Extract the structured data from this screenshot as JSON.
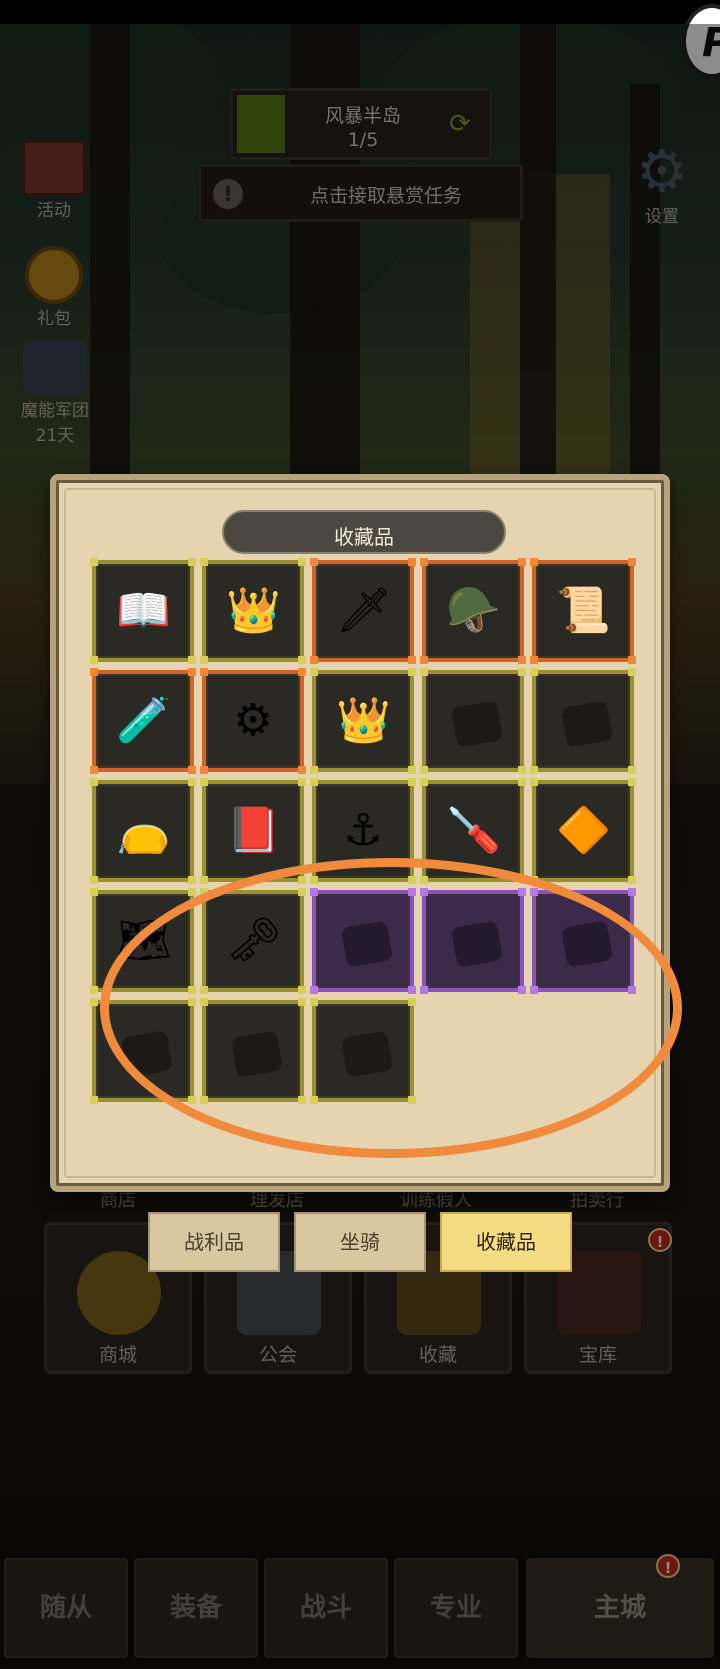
{
  "hud": {
    "region_name": "风暴半岛",
    "region_progress": "1/5",
    "region_progress_value": 0.2,
    "quest_text": "点击接取悬赏任务"
  },
  "side_menu": {
    "activity": "活动",
    "gift": "礼包",
    "legion": "魔能军团",
    "legion_timer": "21天",
    "settings": "设置"
  },
  "background_buttons": {
    "top_row": [
      "商店",
      "理发店",
      "训练假人",
      "拍卖行"
    ],
    "cards": [
      "商城",
      "公会",
      "收藏",
      "宝库"
    ]
  },
  "modal": {
    "title": "收藏品",
    "slots": [
      {
        "rarity": "gold",
        "icon": "book-icon",
        "glyph": "📖"
      },
      {
        "rarity": "gold",
        "icon": "gold-helmet-icon",
        "glyph": "👑"
      },
      {
        "rarity": "orange",
        "icon": "winged-sword-icon",
        "glyph": "🗡"
      },
      {
        "rarity": "orange",
        "icon": "crown-helmet-icon",
        "glyph": "🪖"
      },
      {
        "rarity": "orange",
        "icon": "scroll-feather-icon",
        "glyph": "📜"
      },
      {
        "rarity": "orange",
        "icon": "potion-icon",
        "glyph": "🧪"
      },
      {
        "rarity": "orange",
        "icon": "gear-orb-icon",
        "glyph": "⚙"
      },
      {
        "rarity": "gold",
        "icon": "royal-crown-icon",
        "glyph": "👑"
      },
      {
        "rarity": "gold",
        "icon": "locked-item-icon",
        "glyph": ""
      },
      {
        "rarity": "gold",
        "icon": "locked-item-icon",
        "glyph": ""
      },
      {
        "rarity": "gold",
        "icon": "pouch-icon",
        "glyph": "👝"
      },
      {
        "rarity": "gold",
        "icon": "tome-icon",
        "glyph": "📕"
      },
      {
        "rarity": "gold",
        "icon": "hook-icon",
        "glyph": "⚓"
      },
      {
        "rarity": "gold",
        "icon": "screwdriver-icon",
        "glyph": "🪛"
      },
      {
        "rarity": "gold",
        "icon": "amber-gem-icon",
        "glyph": "🔶"
      },
      {
        "rarity": "gold",
        "icon": "map-icon",
        "glyph": "🗺"
      },
      {
        "rarity": "gold",
        "icon": "ornate-key-icon",
        "glyph": "🗝"
      },
      {
        "rarity": "purple",
        "icon": "locked-item-icon",
        "glyph": ""
      },
      {
        "rarity": "purple",
        "icon": "locked-item-icon",
        "glyph": ""
      },
      {
        "rarity": "purple",
        "icon": "locked-item-icon",
        "glyph": ""
      },
      {
        "rarity": "gold",
        "icon": "locked-item-icon",
        "glyph": ""
      },
      {
        "rarity": "gold",
        "icon": "locked-item-icon",
        "glyph": ""
      },
      {
        "rarity": "gold",
        "icon": "locked-item-icon",
        "glyph": ""
      }
    ]
  },
  "tabs": [
    "战利品",
    "坐骑",
    "收藏品"
  ],
  "active_tab": "收藏品",
  "bottom_nav": [
    "随从",
    "装备",
    "战斗",
    "专业",
    "主城"
  ],
  "colors": {
    "gold_frame": "#9a9030",
    "orange_frame": "#d06424",
    "purple_frame": "#8d4fc2",
    "annotation": "#f08a3c",
    "badge": "#c22a1a"
  }
}
